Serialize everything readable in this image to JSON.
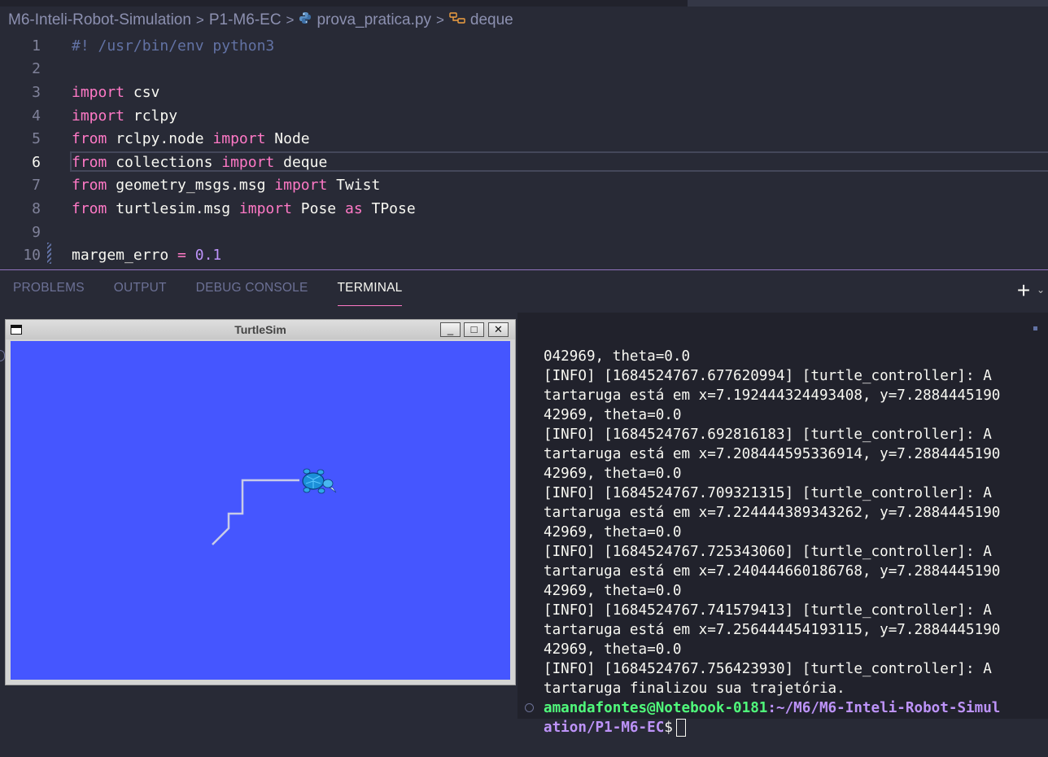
{
  "breadcrumb": {
    "items": [
      "M6-Inteli-Robot-Simulation",
      "P1-M6-EC",
      "prova_pratica.py",
      "deque"
    ],
    "separator": ">"
  },
  "editor": {
    "lines": [
      {
        "n": "1",
        "text": "#! /usr/bin/env python3"
      },
      {
        "n": "2",
        "text": ""
      },
      {
        "n": "3",
        "text": "import csv"
      },
      {
        "n": "4",
        "text": "import rclpy"
      },
      {
        "n": "5",
        "text": "from rclpy.node import Node"
      },
      {
        "n": "6",
        "text": "from collections import deque"
      },
      {
        "n": "7",
        "text": "from geometry_msgs.msg import Twist"
      },
      {
        "n": "8",
        "text": "from turtlesim.msg import Pose as TPose"
      },
      {
        "n": "9",
        "text": ""
      },
      {
        "n": "10",
        "text": "margem_erro = 0.1"
      }
    ],
    "active_line": "6",
    "tokens": {
      "l1": "#! /usr/bin/env python3",
      "import": "import",
      "from": "from",
      "as": "as",
      "csv": " csv",
      "rclpy": " rclpy",
      "rclpy_node": " rclpy.node ",
      "Node": " Node",
      "collections": " collections ",
      "deque": " deque",
      "geometry": " geometry_msgs.msg ",
      "Twist": " Twist",
      "turtlesim": " turtlesim.msg ",
      "Pose": " Pose ",
      "TPose": " TPose",
      "margem": "margem_erro ",
      "eq": "=",
      "val": " 0.1"
    }
  },
  "panel": {
    "tabs": [
      "PROBLEMS",
      "OUTPUT",
      "DEBUG CONSOLE",
      "TERMINAL"
    ],
    "active_tab": "TERMINAL",
    "new_terminal": "+",
    "dropdown": "⌄"
  },
  "turtlesim": {
    "title": "TurtleSim",
    "buttons": [
      "_",
      "□",
      "✕"
    ],
    "background": "#4556ff"
  },
  "terminal": {
    "lines": [
      "042969, theta=0.0",
      "[INFO] [1684524767.677620994] [turtle_controller]: A",
      "tartaruga está em x=7.192444324493408, y=7.2884445190",
      "42969, theta=0.0",
      "[INFO] [1684524767.692816183] [turtle_controller]: A",
      "tartaruga está em x=7.208444595336914, y=7.2884445190",
      "42969, theta=0.0",
      "[INFO] [1684524767.709321315] [turtle_controller]: A",
      "tartaruga está em x=7.224444389343262, y=7.2884445190",
      "42969, theta=0.0",
      "[INFO] [1684524767.725343060] [turtle_controller]: A",
      "tartaruga está em x=7.240444660186768, y=7.2884445190",
      "42969, theta=0.0",
      "[INFO] [1684524767.741579413] [turtle_controller]: A",
      "tartaruga está em x=7.256444454193115, y=7.2884445190",
      "42969, theta=0.0",
      "[INFO] [1684524767.756423930] [turtle_controller]: A",
      "tartaruga finalizou sua trajetória."
    ],
    "prompt_user": "amandafontes@Notebook-0181",
    "prompt_path_1": ":~/M6/M6-Inteli-Robot-Simul",
    "prompt_path_2": "ation/P1-M6-EC",
    "prompt_symbol": "$"
  },
  "colors": {
    "keyword": "#ff79c6",
    "comment": "#6272a4",
    "number": "#bd93f9",
    "prompt_user": "#50fa7b",
    "prompt_path": "#bd93f9"
  }
}
